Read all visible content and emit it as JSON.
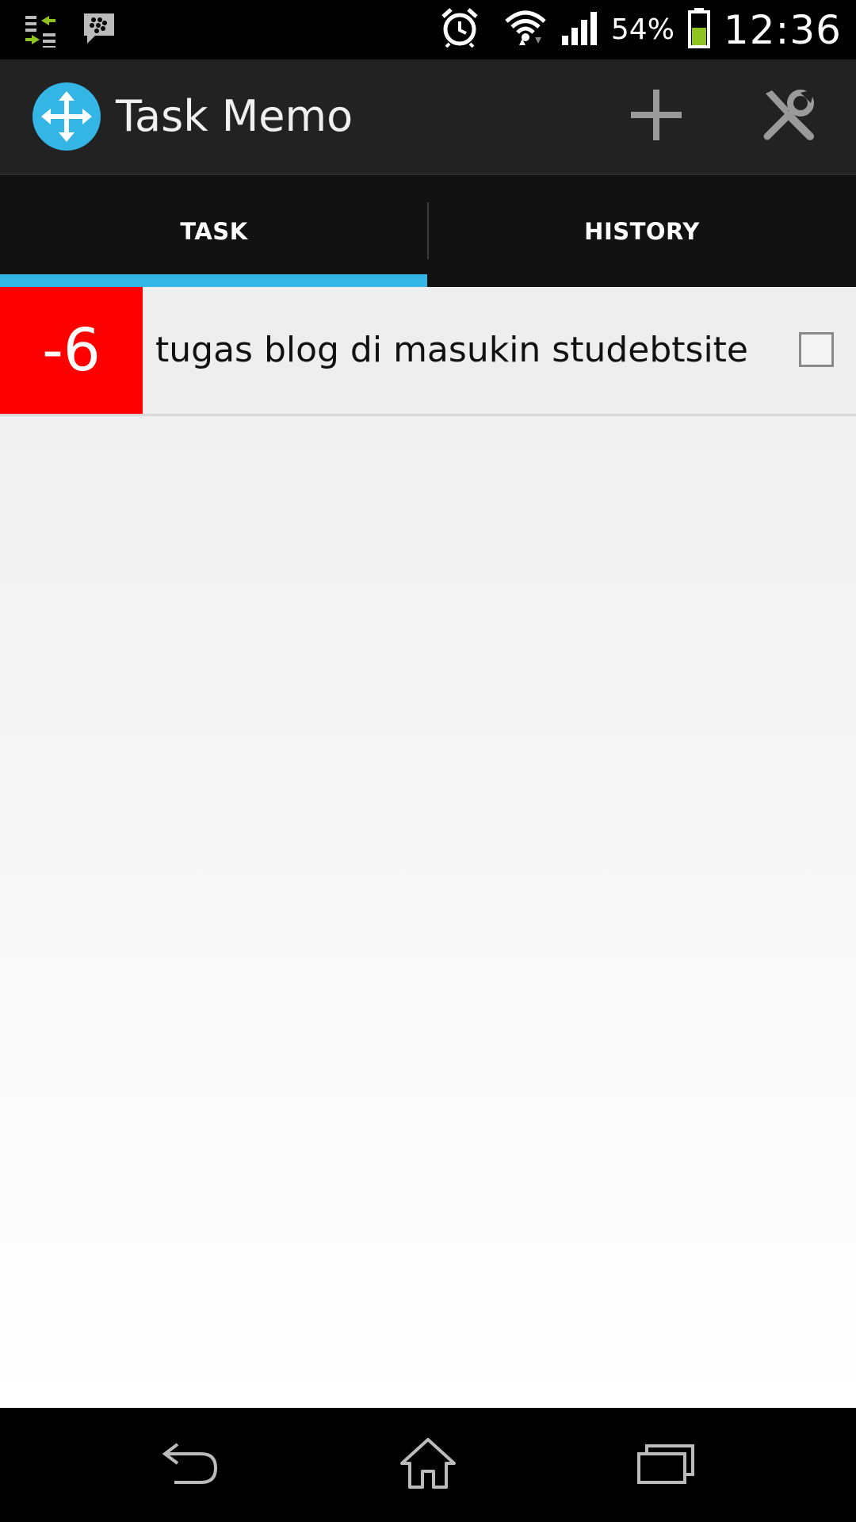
{
  "status_bar": {
    "notification_icons": [
      "data-transfer-icon",
      "bbm-chat-icon"
    ],
    "system_icons": [
      "alarm-icon",
      "wifi-icon",
      "signal-icon",
      "battery-icon"
    ],
    "battery_percent": "54%",
    "battery_level": 0.54,
    "time": "12:36"
  },
  "action_bar": {
    "logo_icon": "move-arrows-icon",
    "title": "Task Memo",
    "actions": [
      "add-icon",
      "tools-icon"
    ]
  },
  "tabs": [
    {
      "label": "TASK",
      "selected": true
    },
    {
      "label": "HISTORY",
      "selected": false
    }
  ],
  "tasks": [
    {
      "days": "-6",
      "text": "tugas blog di masukin studebtsite",
      "checked": false
    }
  ],
  "colors": {
    "accent": "#33b5e5",
    "overdue": "#ff0000",
    "action_bar": "#222222",
    "battery_fill": "#8fc31f"
  },
  "nav_bar": {
    "buttons": [
      "back-icon",
      "home-icon",
      "recent-apps-icon"
    ]
  }
}
